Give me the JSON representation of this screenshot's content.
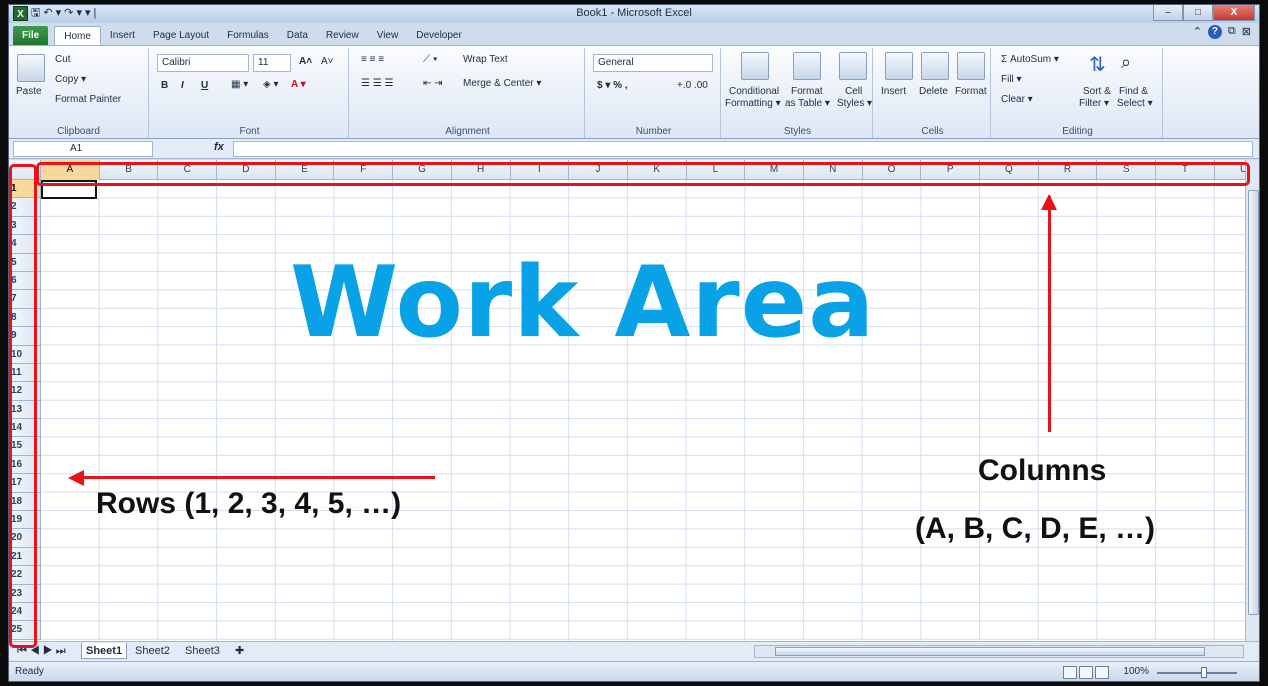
{
  "window": {
    "title": "Book1 - Microsoft Excel",
    "min": "–",
    "max": "□",
    "close": "X"
  },
  "qat": {
    "app_icon": "X",
    "save": "🖫",
    "undo": "↶ ▾",
    "redo": "↷ ▾",
    "customize": "▾ |"
  },
  "tabs": [
    {
      "label": "File"
    },
    {
      "label": "Home"
    },
    {
      "label": "Insert"
    },
    {
      "label": "Page Layout"
    },
    {
      "label": "Formulas"
    },
    {
      "label": "Data"
    },
    {
      "label": "Review"
    },
    {
      "label": "View"
    },
    {
      "label": "Developer"
    }
  ],
  "ribbon": {
    "clipboard": {
      "paste": "Paste",
      "cut": "Cut",
      "copy": "Copy ▾",
      "format_painter": "Format Painter",
      "label": "Clipboard"
    },
    "font": {
      "name": "Calibri",
      "size": "11",
      "bold": "B",
      "italic": "I",
      "underline": "U",
      "grow": "A˄",
      "shrink": "A˅",
      "label": "Font"
    },
    "alignment": {
      "wrap": "Wrap Text",
      "merge": "Merge & Center ▾",
      "label": "Alignment"
    },
    "number": {
      "format": "General",
      "currency": "$ ▾ % ,",
      "decimals": "+.0 .00",
      "label": "Number"
    },
    "styles": {
      "conditional": "Conditional",
      "conditional2": "Formatting ▾",
      "format_table": "Format",
      "format_table2": "as Table ▾",
      "cell_styles": "Cell",
      "cell_styles2": "Styles ▾",
      "label": "Styles"
    },
    "cells": {
      "insert": "Insert",
      "delete": "Delete",
      "format": "Format",
      "label": "Cells"
    },
    "editing": {
      "autosum": "Σ AutoSum ▾",
      "fill": "Fill ▾",
      "clear": "Clear ▾",
      "sort": "Sort &",
      "sort2": "Filter ▾",
      "find": "Find &",
      "find2": "Select ▾",
      "label": "Editing"
    }
  },
  "formula_bar": {
    "name_box": "A1",
    "fx": "fx",
    "value": ""
  },
  "columns": [
    "A",
    "B",
    "C",
    "D",
    "E",
    "F",
    "G",
    "H",
    "I",
    "J",
    "K",
    "L",
    "M",
    "N",
    "O",
    "P",
    "Q",
    "R",
    "S",
    "T",
    "U"
  ],
  "rows": [
    "1",
    "2",
    "3",
    "4",
    "5",
    "6",
    "7",
    "8",
    "9",
    "10",
    "11",
    "12",
    "13",
    "14",
    "15",
    "16",
    "17",
    "18",
    "19",
    "20",
    "21",
    "22",
    "23",
    "24",
    "25"
  ],
  "sheets": {
    "active": "Sheet1",
    "others": [
      "Sheet2",
      "Sheet3"
    ]
  },
  "status": {
    "ready": "Ready",
    "zoom": "100%"
  },
  "overlay": {
    "work_area": "Work Area",
    "rows_label": "Rows (1, 2, 3, 4, 5, …)",
    "columns_label": "Columns",
    "columns_list": "(A, B, C, D, E, …)"
  },
  "colors": {
    "accent": "#0aa2e6",
    "annotation_red": "#e8121b",
    "file_tab": "#207530"
  }
}
